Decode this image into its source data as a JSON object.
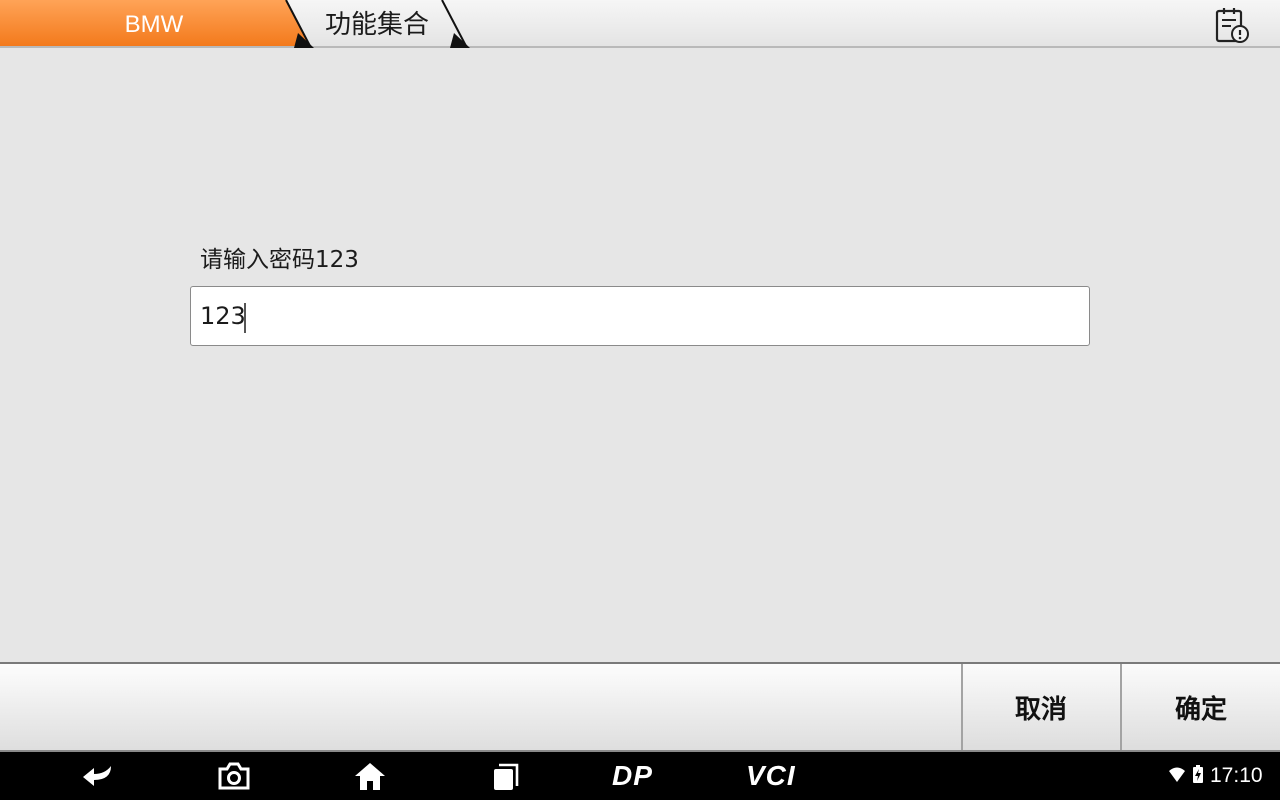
{
  "breadcrumb": {
    "items": [
      {
        "label": "BMW"
      },
      {
        "label": "功能集合"
      }
    ]
  },
  "header": {
    "report_icon": "clipboard-alert-icon"
  },
  "main": {
    "prompt_label": "请输入密码123",
    "password_value": "123"
  },
  "actions": {
    "cancel_label": "取消",
    "ok_label": "确定"
  },
  "navbar": {
    "icons": [
      "back-icon",
      "camera-icon",
      "home-icon",
      "recent-apps-icon"
    ],
    "dp_label": "DP",
    "vci_label": "VCI",
    "time": "17:10"
  },
  "colors": {
    "accent_orange": "#f37a1c",
    "background": "#e6e6e6"
  }
}
